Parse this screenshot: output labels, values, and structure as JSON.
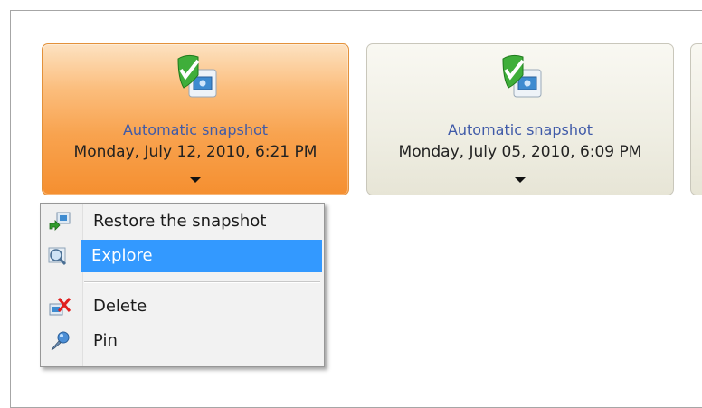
{
  "snapshots": [
    {
      "title": "Automatic snapshot",
      "date": "Monday, July 12, 2010, 6:21 PM"
    },
    {
      "title": "Automatic snapshot",
      "date": "Monday, July 05, 2010, 6:09 PM"
    }
  ],
  "context_menu": {
    "items": [
      {
        "label": "Restore the snapshot",
        "icon": "restore-icon"
      },
      {
        "label": "Explore",
        "icon": "magnifier-icon"
      },
      {
        "label": "Delete",
        "icon": "delete-icon"
      },
      {
        "label": "Pin",
        "icon": "pin-icon"
      }
    ],
    "highlighted": "Explore"
  },
  "colors": {
    "selected_card": "#f8a34f",
    "card": "#efeee3",
    "title_text": "#3f5aa8",
    "highlight": "#3399ff"
  }
}
